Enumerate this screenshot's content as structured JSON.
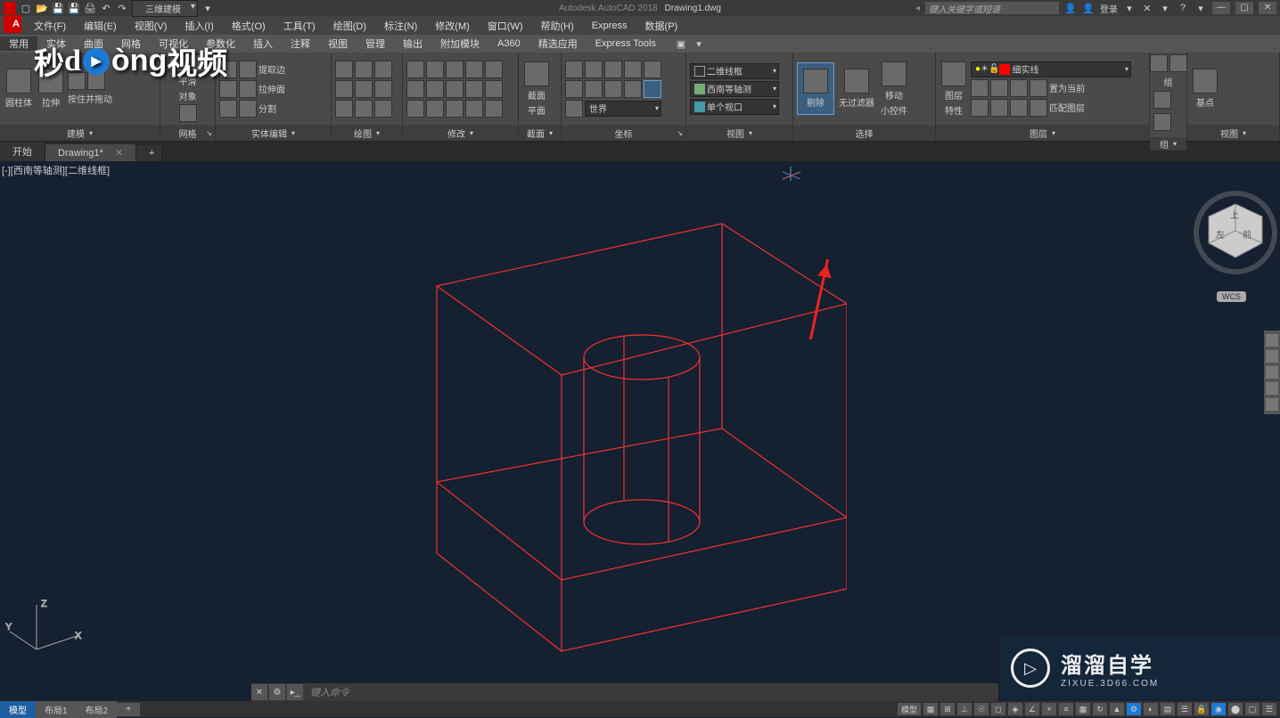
{
  "titlebar": {
    "workspace": "三维建模",
    "app": "Autodesk AutoCAD 2018",
    "file": "Drawing1.dwg",
    "search_placeholder": "键入关键字或短语",
    "login": "登录"
  },
  "menubar": [
    "文件(F)",
    "编辑(E)",
    "视图(V)",
    "插入(I)",
    "格式(O)",
    "工具(T)",
    "绘图(D)",
    "标注(N)",
    "修改(M)",
    "窗口(W)",
    "帮助(H)",
    "Express",
    "数据(P)"
  ],
  "ribbontabs": [
    "常用",
    "实体",
    "曲面",
    "网格",
    "可视化",
    "参数化",
    "插入",
    "注释",
    "视图",
    "管理",
    "输出",
    "附加模块",
    "A360",
    "精选应用",
    "Express Tools"
  ],
  "panels": {
    "p1": {
      "title": "建模",
      "btn1": "圆柱体",
      "btn2": "拉伸",
      "btn3": "按住并拖动"
    },
    "p2": {
      "title": "网格",
      "btn1": "平滑",
      "btn2": "对象"
    },
    "p3": {
      "title": "实体编辑",
      "r1": "提取边",
      "r2": "拉伸面",
      "r3": "分割"
    },
    "p4": {
      "title": "绘图"
    },
    "p5": {
      "title": "修改"
    },
    "p6": {
      "title": "截面",
      "btn1": "截面",
      "btn2": "平面"
    },
    "p7": {
      "title": "坐标",
      "sel1": "世界"
    },
    "p8": {
      "title": "视图",
      "sel1": "二维线框",
      "sel2": "西南等轴测",
      "sel3": "单个视口"
    },
    "p9": {
      "title": "选择",
      "btn1": "剔除",
      "btn2": "无过滤器",
      "btn3": "移动",
      "btn4": "小控件"
    },
    "p10": {
      "title": "图层",
      "btn1": "图层",
      "btn2": "特性",
      "sel": "细实线",
      "opt1": "置为当前",
      "opt2": "匹配图层"
    },
    "p11": {
      "title": "组",
      "lbl": "组"
    },
    "p12": {
      "title": "视图",
      "btn": "基点"
    }
  },
  "doctabs": {
    "t1": "开始",
    "t2": "Drawing1*"
  },
  "viewport_label": "[-][西南等轴测][二维线框]",
  "wcs": "WCS",
  "ucs": {
    "x": "X",
    "y": "Y",
    "z": "Z"
  },
  "watermark": {
    "t1": "溜溜自学",
    "t2": "ZIXUE.3D66.COM"
  },
  "overlay_logo": {
    "a": "秒",
    "b": "òng",
    "c": "视频"
  },
  "cmdline": {
    "placeholder": "键入命令"
  },
  "btabs": {
    "t1": "模型",
    "t2": "布局1",
    "t3": "布局2",
    "mode": "模型"
  },
  "colors": {
    "accent": "#e22",
    "hilite": "#3b5f7f"
  }
}
